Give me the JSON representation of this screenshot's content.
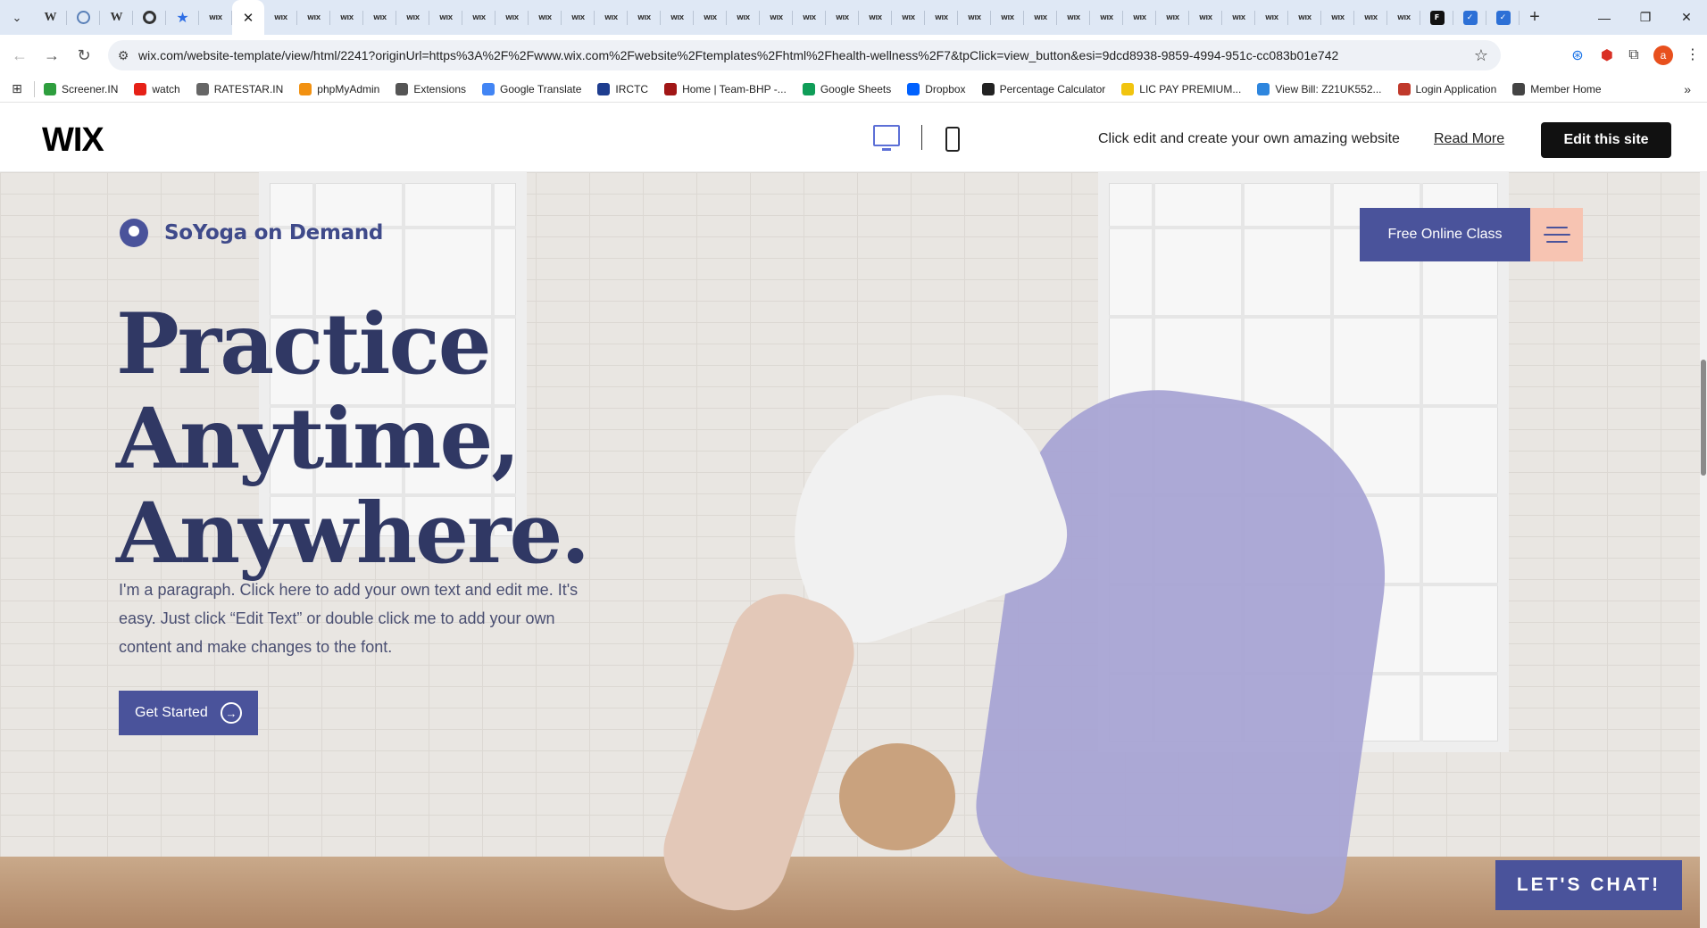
{
  "browser": {
    "tabs": [
      {
        "icon": "w-icon",
        "glyph": "W"
      },
      {
        "icon": "globe-icon",
        "glyph": ""
      },
      {
        "icon": "w-icon",
        "glyph": "W"
      },
      {
        "icon": "circle-icon",
        "glyph": ""
      },
      {
        "icon": "star-icon",
        "glyph": "★"
      }
    ],
    "wix_tab_glyph": "WIX",
    "active_close": "✕",
    "new_tab": "+",
    "url": "wix.com/website-template/view/html/2241?originUrl=https%3A%2F%2Fwww.wix.com%2Fwebsite%2Ftemplates%2Fhtml%2Fhealth-wellness%2F7&tpClick=view_button&esi=9dcd8938-9859-4994-951c-cc083b01e742",
    "profile_initial": "a"
  },
  "bookmarks": [
    {
      "label": "Screener.IN",
      "icon": "bar-chart-icon",
      "color": "#2e9e3e"
    },
    {
      "label": "watch",
      "icon": "youtube-icon",
      "color": "#e62117"
    },
    {
      "label": "RATESTAR.IN",
      "icon": "ratestar-icon",
      "color": "#666666"
    },
    {
      "label": "phpMyAdmin",
      "icon": "phpmyadmin-icon",
      "color": "#f29111"
    },
    {
      "label": "Extensions",
      "icon": "puzzle-icon",
      "color": "#555555"
    },
    {
      "label": "Google Translate",
      "icon": "translate-icon",
      "color": "#4285f4"
    },
    {
      "label": "IRCTC",
      "icon": "irctc-icon",
      "color": "#1e3d8f"
    },
    {
      "label": "Home | Team-BHP -...",
      "icon": "teambhp-icon",
      "color": "#a11616"
    },
    {
      "label": "Google Sheets",
      "icon": "sheets-icon",
      "color": "#0f9d58"
    },
    {
      "label": "Dropbox",
      "icon": "dropbox-icon",
      "color": "#0061fe"
    },
    {
      "label": "Percentage Calculator",
      "icon": "percent-icon",
      "color": "#222222"
    },
    {
      "label": "LIC PAY PREMIUM...",
      "icon": "lic-icon",
      "color": "#f1c40f"
    },
    {
      "label": "View Bill: Z21UK552...",
      "icon": "bill-icon",
      "color": "#2e86de"
    },
    {
      "label": "Login Application",
      "icon": "login-icon",
      "color": "#c0392b"
    },
    {
      "label": "Member Home",
      "icon": "member-icon",
      "color": "#444444"
    }
  ],
  "wixbar": {
    "logo": "WIX",
    "tagline": "Click edit and create your own amazing website",
    "read_more": "Read More",
    "edit_button": "Edit this site"
  },
  "site": {
    "brand": "SoYoga on Demand",
    "free_class": "Free Online Class",
    "headline_line1": "Practice Anytime,",
    "headline_line2": "Anywhere.",
    "paragraph": "I'm a paragraph. Click here to add your own text and edit me. It's easy. Just click “Edit Text” or double click me to add your own content and make changes to the font.",
    "cta": "Get Started",
    "chat": "LET'S CHAT!"
  },
  "colors": {
    "brand_primary": "#4a539b",
    "heading": "#303864",
    "menu_accent": "#f7c4b2"
  }
}
